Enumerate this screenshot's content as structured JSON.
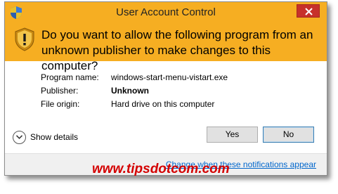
{
  "window": {
    "title": "User Account Control",
    "close_icon": "close-icon"
  },
  "header": {
    "shield_icon": "uac-shield-icon",
    "question": "Do you want to allow the following program from an unknown publisher to make changes to this computer?"
  },
  "info": {
    "rows": [
      {
        "label": "Program name:",
        "value": "windows-start-menu-vistart.exe",
        "bold": false
      },
      {
        "label": "Publisher:",
        "value": "Unknown",
        "bold": true
      },
      {
        "label": "File origin:",
        "value": "Hard drive on this computer",
        "bold": false
      }
    ]
  },
  "details": {
    "label": "Show details",
    "icon": "chevron-down-icon"
  },
  "buttons": {
    "yes": "Yes",
    "no": "No"
  },
  "footer": {
    "link": "Change when these notifications appear"
  },
  "watermark": "www.tipsdotcom.com",
  "colors": {
    "accent": "#f6ae22",
    "close": "#c7312b",
    "link": "#0066cc",
    "watermark": "#d40000"
  }
}
